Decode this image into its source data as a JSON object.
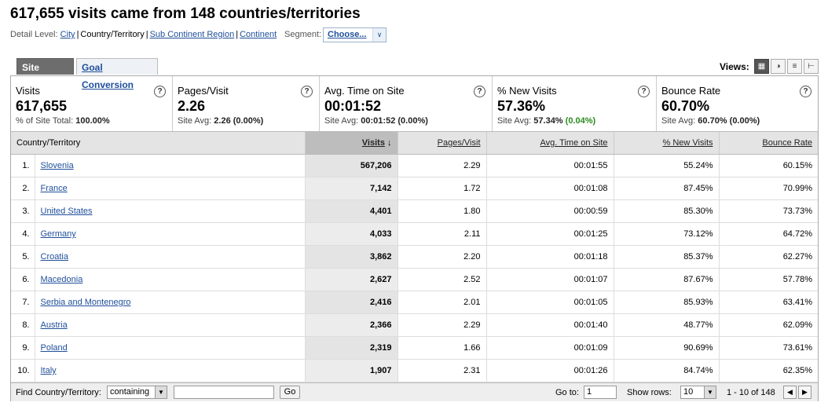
{
  "header": {
    "title": "617,655 visits came from 148 countries/territories",
    "detail_label": "Detail Level:",
    "detail_city": "City",
    "detail_current": "Country/Territory",
    "detail_subcontinent": "Sub Continent Region",
    "detail_continent": "Continent",
    "segment_label": "Segment:",
    "segment_value": "Choose..."
  },
  "tabs": {
    "site_usage": "Site Usage",
    "goal_conversion": "Goal Conversion"
  },
  "views": {
    "label": "Views:",
    "icons": [
      "table-view-icon",
      "pie-view-icon",
      "performance-view-icon",
      "comparison-view-icon"
    ]
  },
  "metrics": [
    {
      "name": "Visits",
      "value": "617,655",
      "sub_label": "% of Site Total:",
      "sub_value": "100.00%",
      "sub_delta": ""
    },
    {
      "name": "Pages/Visit",
      "value": "2.26",
      "sub_label": "Site Avg:",
      "sub_value": "2.26",
      "sub_delta": "(0.00%)"
    },
    {
      "name": "Avg. Time on Site",
      "value": "00:01:52",
      "sub_label": "Site Avg:",
      "sub_value": "00:01:52",
      "sub_delta": "(0.00%)"
    },
    {
      "name": "% New Visits",
      "value": "57.36%",
      "sub_label": "Site Avg:",
      "sub_value": "57.34%",
      "sub_delta": "(0.04%)"
    },
    {
      "name": "Bounce Rate",
      "value": "60.70%",
      "sub_label": "Site Avg:",
      "sub_value": "60.70%",
      "sub_delta": "(0.00%)"
    }
  ],
  "table": {
    "columns": [
      "Country/Territory",
      "Visits",
      "Pages/Visit",
      "Avg. Time on Site",
      "% New Visits",
      "Bounce Rate"
    ],
    "rows": [
      {
        "idx": "1.",
        "country": "Slovenia",
        "visits": "567,206",
        "pages": "2.29",
        "time": "00:01:55",
        "new": "55.24%",
        "bounce": "60.15%"
      },
      {
        "idx": "2.",
        "country": "France",
        "visits": "7,142",
        "pages": "1.72",
        "time": "00:01:08",
        "new": "87.45%",
        "bounce": "70.99%"
      },
      {
        "idx": "3.",
        "country": "United States",
        "visits": "4,401",
        "pages": "1.80",
        "time": "00:00:59",
        "new": "85.30%",
        "bounce": "73.73%"
      },
      {
        "idx": "4.",
        "country": "Germany",
        "visits": "4,033",
        "pages": "2.11",
        "time": "00:01:25",
        "new": "73.12%",
        "bounce": "64.72%"
      },
      {
        "idx": "5.",
        "country": "Croatia",
        "visits": "3,862",
        "pages": "2.20",
        "time": "00:01:18",
        "new": "85.37%",
        "bounce": "62.27%"
      },
      {
        "idx": "6.",
        "country": "Macedonia",
        "visits": "2,627",
        "pages": "2.52",
        "time": "00:01:07",
        "new": "87.67%",
        "bounce": "57.78%"
      },
      {
        "idx": "7.",
        "country": "Serbia and Montenegro",
        "visits": "2,416",
        "pages": "2.01",
        "time": "00:01:05",
        "new": "85.93%",
        "bounce": "63.41%"
      },
      {
        "idx": "8.",
        "country": "Austria",
        "visits": "2,366",
        "pages": "2.29",
        "time": "00:01:40",
        "new": "48.77%",
        "bounce": "62.09%"
      },
      {
        "idx": "9.",
        "country": "Poland",
        "visits": "2,319",
        "pages": "1.66",
        "time": "00:01:09",
        "new": "90.69%",
        "bounce": "73.61%"
      },
      {
        "idx": "10.",
        "country": "Italy",
        "visits": "1,907",
        "pages": "2.31",
        "time": "00:01:26",
        "new": "84.74%",
        "bounce": "62.35%"
      }
    ]
  },
  "footer": {
    "find_label": "Find Country/Territory:",
    "filter_mode": "containing",
    "filter_value": "",
    "go": "Go",
    "goto_label": "Go to:",
    "goto_value": "1",
    "show_rows_label": "Show rows:",
    "show_rows_value": "10",
    "range": "1 - 10 of 148"
  },
  "colors": {
    "link": "#1f4f9b",
    "positive": "#2a8a1f",
    "sorted_header": "#bdbdbd"
  }
}
